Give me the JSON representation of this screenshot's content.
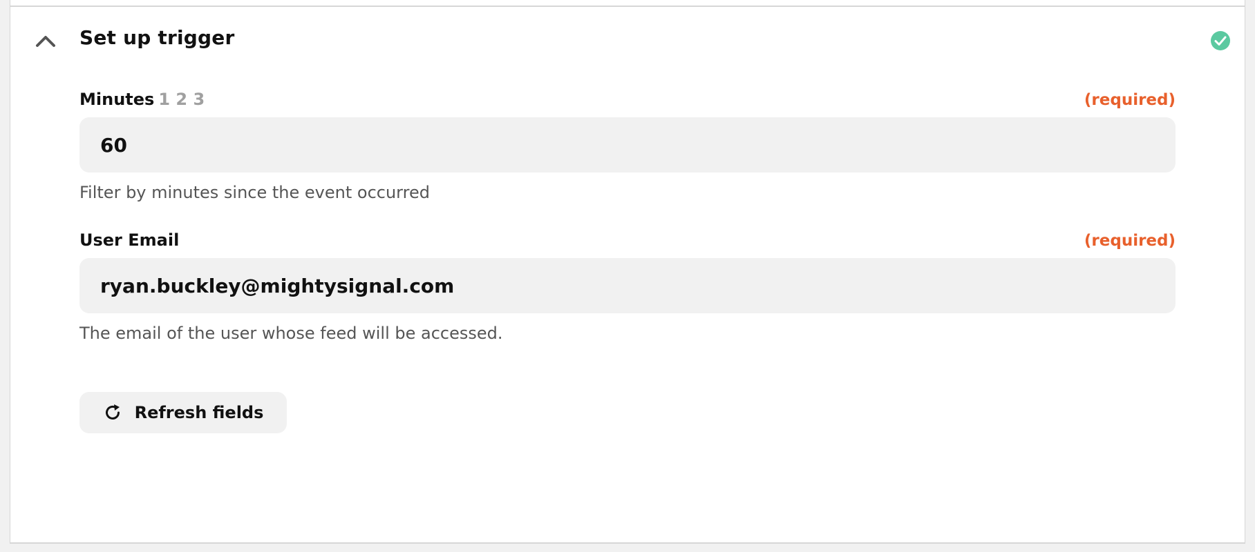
{
  "section": {
    "title": "Set up trigger",
    "toggle_icon": "chevron-up-icon",
    "status_icon": "check-circle-icon",
    "status_color": "#5bc9a0"
  },
  "fields": {
    "minutes": {
      "label": "Minutes",
      "label_extras": "1 2 3",
      "required": "(required)",
      "value": "60",
      "help": "Filter by minutes since the event occurred"
    },
    "user_email": {
      "label": "User Email",
      "required": "(required)",
      "value": "ryan.buckley@mightysignal.com",
      "help": "The email of the user whose feed will be accessed."
    }
  },
  "actions": {
    "refresh_label": "Refresh fields",
    "refresh_icon": "refresh-icon"
  },
  "colors": {
    "required": "#e8602c",
    "input_bg": "#f1f1f1",
    "success": "#5bc9a0"
  }
}
